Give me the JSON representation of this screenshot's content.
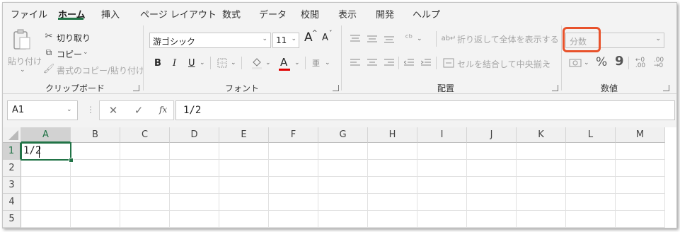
{
  "tabs": [
    "ファイル",
    "ホーム",
    "挿入",
    "ページ レイアウト",
    "数式",
    "データ",
    "校閲",
    "表示",
    "開発",
    "ヘルプ"
  ],
  "active_tab": "ホーム",
  "clipboard": {
    "paste_label": "貼り付け",
    "cut_label": "切り取り",
    "copy_label": "コピー",
    "format_painter_label": "書式のコピー/貼り付け",
    "group_label": "クリップボード"
  },
  "font": {
    "font_name": "游ゴシック",
    "font_size": "11",
    "bold": "B",
    "italic": "I",
    "underline": "U",
    "grow": "A",
    "shrink": "A",
    "color_letter": "A",
    "phonetic": "亜",
    "group_label": "フォント"
  },
  "alignment": {
    "wrap_label": "折り返して全体を表示する",
    "merge_label": "セルを結合して中央揃え",
    "group_label": "配置"
  },
  "number": {
    "format_value": "分数",
    "percent": "%",
    "comma": "9",
    "group_label": "数値"
  },
  "formula_bar": {
    "name_box": "A1",
    "fx": "fx",
    "content": "1/2"
  },
  "sheet": {
    "columns": [
      "A",
      "B",
      "C",
      "D",
      "E",
      "F",
      "G",
      "H",
      "I",
      "J",
      "K",
      "L",
      "M"
    ],
    "rows": [
      "1",
      "2",
      "3",
      "4",
      "5"
    ],
    "a1_value": "1/2"
  },
  "colors": {
    "accent": "#217346",
    "highlight": "#e8522b"
  }
}
